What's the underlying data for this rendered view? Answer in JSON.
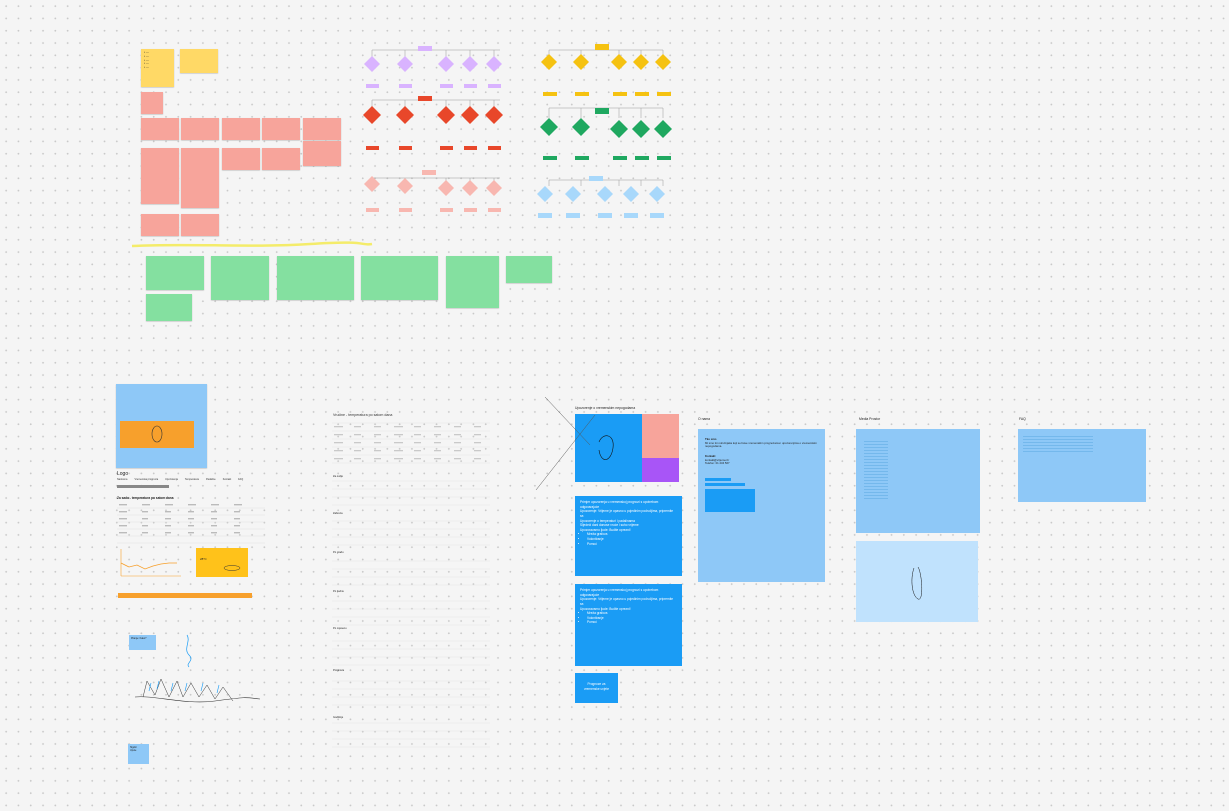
{
  "board": {
    "background": "#f5f5f5",
    "colors": {
      "yellow": "#ffd966",
      "red": "#f7a49b",
      "green": "#84e0a0",
      "light_blue": "#8ec8f7",
      "blue": "#1a9cf5",
      "orange": "#f7a02c",
      "purple": "#a855f7"
    }
  },
  "misc_labels": {
    "recom_heading": "Upozorenje o vremenskim nepogodama",
    "popup_note": "Pitanje: Kako?",
    "small_note": "Slgdor\nUpute"
  },
  "mockup": {
    "logo": "Logo",
    "tabs": [
      "Naslovna",
      "Vremenska prognoza",
      "Upozorenja",
      "Temperatura",
      "Padaline",
      "Kontakt",
      "FAQ"
    ],
    "title_line": "Za sada - temperatura po satom dana",
    "gauge_value": "28°C"
  },
  "weather_page": {
    "title": "Vrućine - temperatura po satom dana",
    "panels": [
      "Za ovdje",
      "Zabreza",
      "Po gradu",
      "Po tjednu",
      "Po mjesecu",
      "Prognoza",
      "Godišnje"
    ],
    "header": [
      "Vrijeme",
      "Temp",
      "Osjet",
      "Vlaga",
      "Vjetar",
      "Tlak",
      "UV",
      "Padalina"
    ],
    "row": [
      "00:00",
      "18°",
      "17°",
      "71%",
      "9 km/h",
      "1015",
      "0",
      "0 mm"
    ]
  },
  "alert_note_1": {
    "lines": [
      "Primjer upozorenja u vremenskoj prognozi s upotrebom odgovarajuće",
      "Upozorenje: Vrijeme je opasno u pojedinim područjima, pripremite se.",
      "Upozorenje o temperaturi i padalinama",
      "Sljedeći dani donose vruće i suho vrijeme",
      "Upozoravamo ljude: Budite oprezni!"
    ],
    "list": [
      "Mreža grafova",
      "Volontiranje",
      "Pomoć"
    ]
  },
  "alert_note_2": {
    "lines": [
      "Primjer upozorenja u vremenskoj prognozi s upotrebom odgovarajuće",
      "Upozorenje: Vrijeme je opasno u pojedinim područjima, pripremite se.",
      "Upozoravamo ljude: Budite oprezni!"
    ],
    "list": [
      "Mreža grafova",
      "Volontiranje",
      "Pomoć"
    ]
  },
  "alert_note_3": "Prognoze za vremenske uvjete",
  "o_nama": {
    "title": "O nama",
    "heading": "Tko smo",
    "body": "Mi smo tim stručnjaka koji se bave vremenskim prognozama i upozorenjima o vremenskim nepogodama.",
    "contact_label": "Kontakt",
    "email": "kontakt@vrijeme.hr",
    "phone": "Telefon: 01 234 567"
  },
  "media_page": {
    "title": "Media Prostor"
  },
  "faq_page": {
    "title": "FAQ"
  }
}
